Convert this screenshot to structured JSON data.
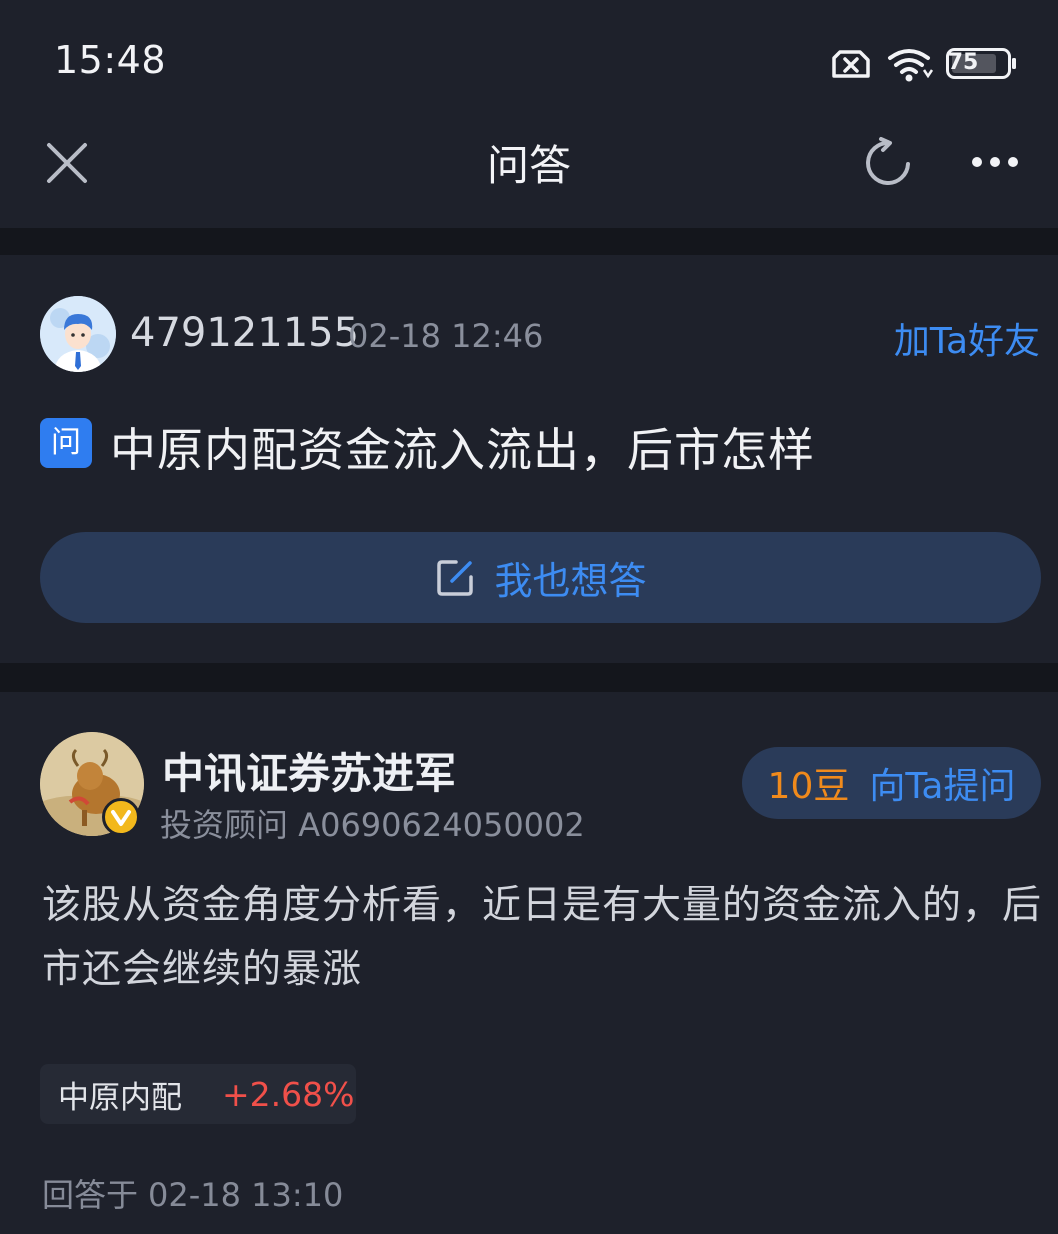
{
  "status_bar": {
    "time": "15:48",
    "battery": "75",
    "icons": [
      "sim-error-icon",
      "wifi-icon",
      "battery-icon"
    ]
  },
  "nav": {
    "title": "问答",
    "close_icon": "close-icon",
    "refresh_icon": "refresh-icon",
    "more_icon": "more-icon"
  },
  "question": {
    "asker_name": "479121155",
    "asked_time": "02-18 12:46",
    "add_friend": "加Ta好友",
    "badge": "问",
    "text": "中原内配资金流入流出，后市怎样",
    "answer_button": "我也想答"
  },
  "answer": {
    "advisor_name": "中讯证券苏进军",
    "advisor_title": "投资顾问",
    "advisor_id": "A0690624050002",
    "ask_price": "10豆",
    "ask_label": "向Ta提问",
    "text": "该股从资金角度分析看，近日是有大量的资金流入的，后市还会继续的暴涨",
    "stock_name": "中原内配",
    "stock_change": "+2.68%",
    "answered_prefix": "回答于",
    "answered_time": "02-18 13:10"
  },
  "colors": {
    "background": "#1e212b",
    "divider": "#14161c",
    "accent_blue": "#3d8cf2",
    "price_orange": "#f08a1c",
    "rise_red": "#f0504a"
  }
}
